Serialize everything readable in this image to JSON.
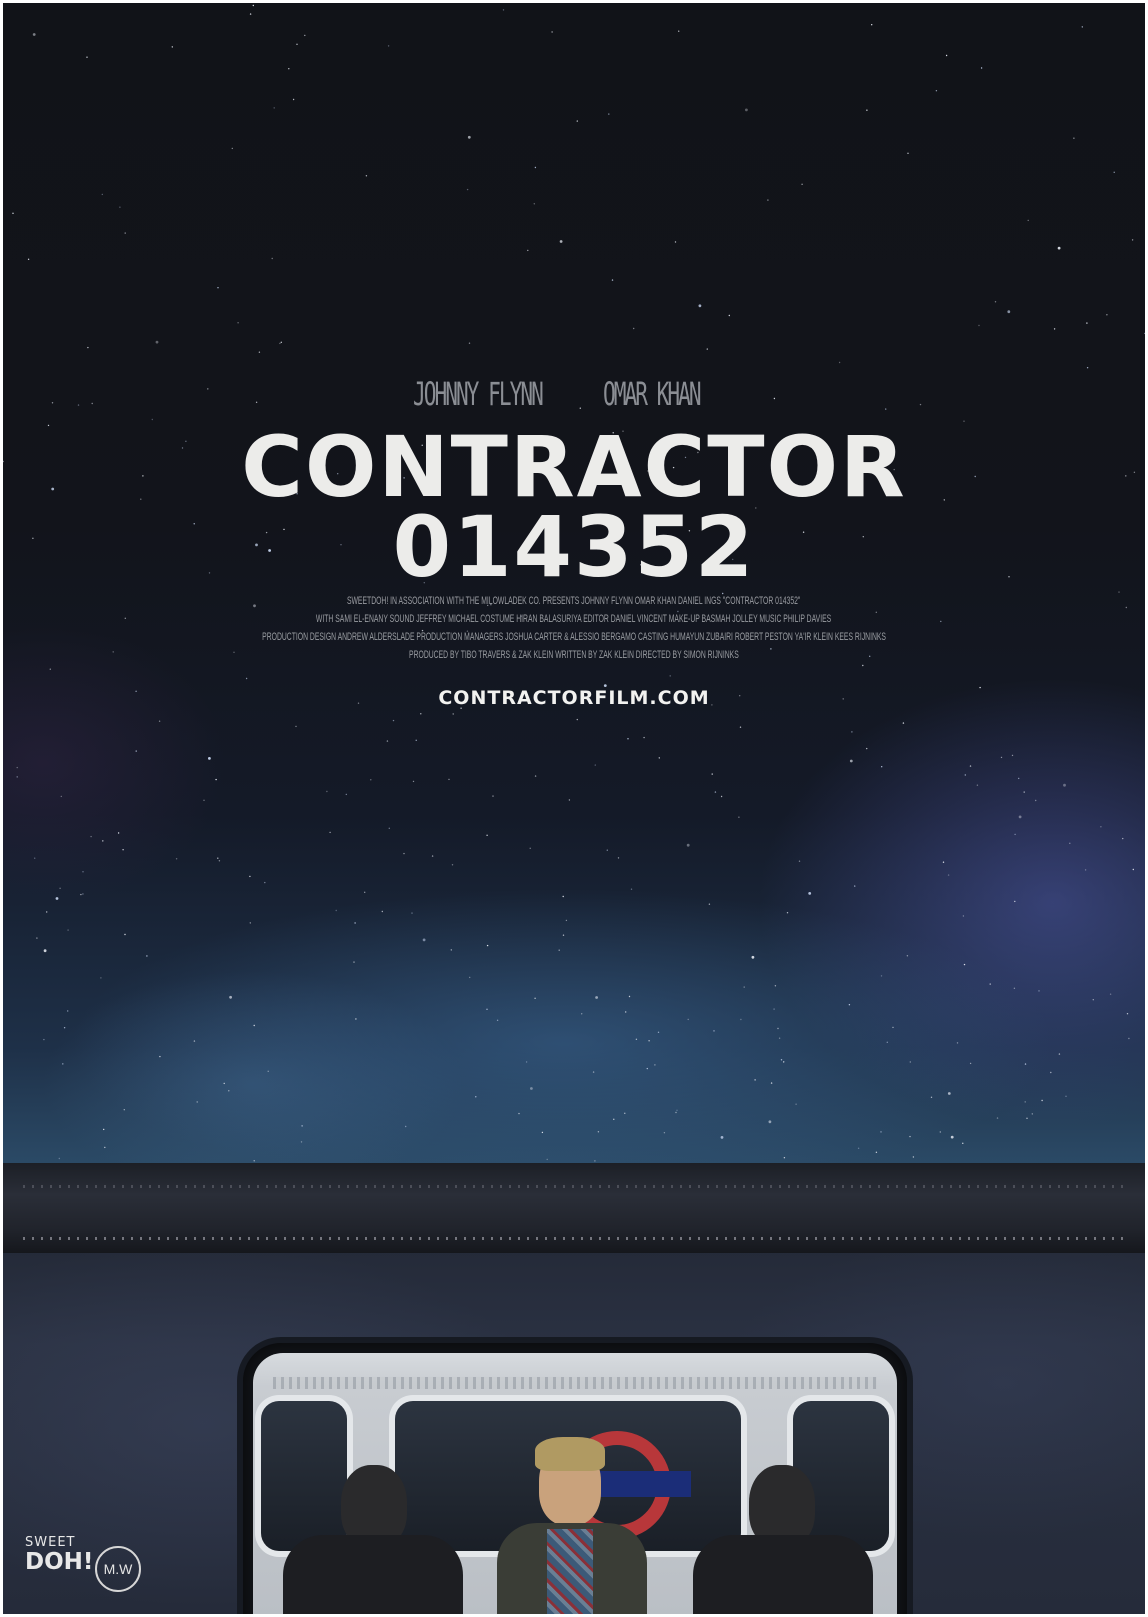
{
  "poster": {
    "cast": [
      "JOHNNY FLYNN",
      "OMAR KHAN"
    ],
    "title_line1": "CONTRACTOR",
    "title_line2": "014352",
    "billing_block": [
      "SWEETDOH! IN ASSOCIATION WITH THE MILOWLADEK CO. PRESENTS JOHNNY FLYNN OMAR KHAN DANIEL INGS \"CONTRACTOR 014352\"",
      "WITH SAMI EL-ENANY SOUND JEFFREY MICHAEL COSTUME HIRAN BALASURIYA EDITOR DANIEL VINCENT MAKE-UP BASMAH JOLLEY MUSIC PHILIP DAVIES",
      "PRODUCTION DESIGN ANDREW ALDERSLADE PRODUCTION MANAGERS JOSHUA CARTER & ALESSIO BERGAMO CASTING HUMAYUN ZUBAIRI ROBERT PESTON YA'IR KLEIN KEES RIJNINKS",
      "PRODUCED BY TIBO TRAVERS & ZAK KLEIN WRITTEN BY ZAK KLEIN DIRECTED BY SIMON RIJNINKS"
    ],
    "website": "CONTRACTORFILM.COM",
    "logos": {
      "sweetdoh_line1": "SWEET",
      "sweetdoh_line2": "DOH!",
      "mw": "M.W"
    }
  },
  "colors": {
    "sky_top": "#111318",
    "nebula_blue": "#2b4a66",
    "title_text": "#ececea",
    "roundel_red": "#b8373a",
    "roundel_blue": "#1b2d78"
  }
}
